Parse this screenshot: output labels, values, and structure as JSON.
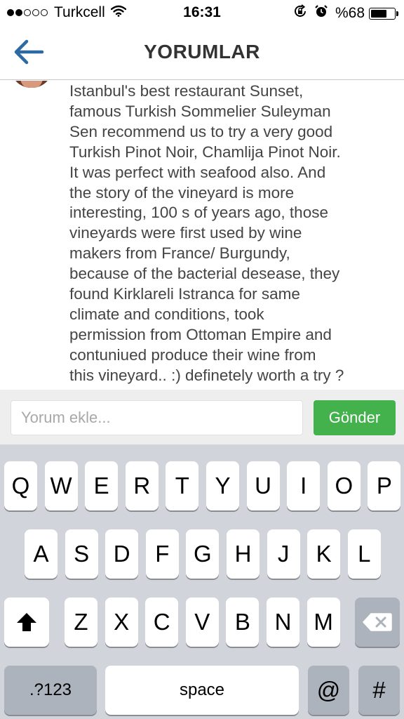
{
  "status_bar": {
    "carrier": "Turkcell",
    "time": "16:31",
    "battery": "%68",
    "battery_level": 0.68,
    "signal_bars_filled": 2,
    "signal_bars_total": 5,
    "icons": [
      "wifi-icon",
      "rotation-lock-icon",
      "alarm-icon",
      "battery-icon"
    ]
  },
  "nav": {
    "title": "YORUMLAR",
    "back_icon": "back-arrow-icon",
    "accent": "#2d6aa3"
  },
  "comment": {
    "lines": [
      "Istanbul's best restaurant Sunset,",
      "famous Turkish Sommelier Suleyman",
      "Sen recommend us to try a very good",
      "Turkish Pinot Noir, Chamlija Pinot Noir.",
      "It was perfect with seafood also. And",
      "the story of the vineyard is more",
      "interesting, 100 s of years ago, those",
      "vineyards were first used by wine",
      "makers from France/ Burgundy,",
      "because of the bacterial desease, they",
      "found Kirklareli Istranca for same",
      "climate and conditions, took",
      "permission from Ottoman Empire and",
      "contuniued produce their wine from",
      "this vineyard.. :) definetely worth a try ?"
    ]
  },
  "input_bar": {
    "placeholder": "Yorum ekle...",
    "value": "",
    "send_label": "Gönder",
    "send_color": "#44b24c"
  },
  "keyboard": {
    "row1": [
      "Q",
      "W",
      "E",
      "R",
      "T",
      "Y",
      "U",
      "I",
      "O",
      "P"
    ],
    "row2": [
      "A",
      "S",
      "D",
      "F",
      "G",
      "H",
      "J",
      "K",
      "L"
    ],
    "row3": [
      "Z",
      "X",
      "C",
      "V",
      "B",
      "N",
      "M"
    ],
    "numbers_label": ".?123",
    "space_label": "space",
    "at_label": "@",
    "hash_label": "#"
  }
}
